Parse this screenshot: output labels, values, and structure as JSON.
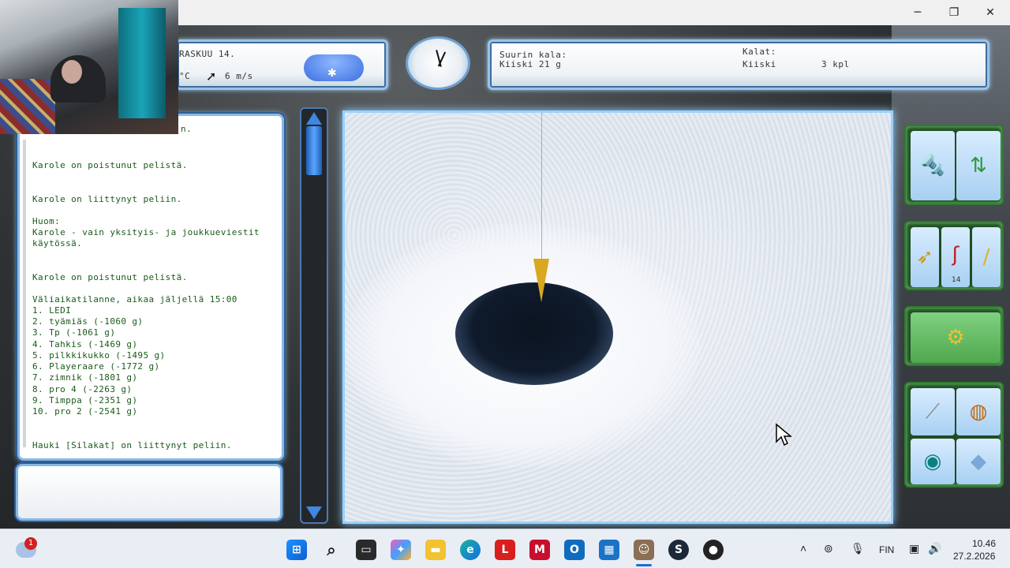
{
  "window": {
    "minimize": "─",
    "maximize": "❐",
    "close": "✕"
  },
  "weather": {
    "date": "RASKUU 14.",
    "temperature_unit": "°C",
    "wind": "6 m/s",
    "icon": "snow-cloud-icon"
  },
  "clock": {
    "icon": "clock-icon"
  },
  "stats": {
    "biggest_label": "Suurin kala:",
    "biggest_value": "Kiiski 21 g",
    "fish_label": "Kalat:",
    "fish_name": "Kiiski",
    "fish_count": "3 kpl"
  },
  "chat": {
    "top_fragment": "n.",
    "lines": [
      "Karole on poistunut pelistä.",
      "Karole on liittynyt peliin.",
      "Huom:",
      "Karole - vain yksityis- ja joukkueviestit",
      "käytössä.",
      "Karole on poistunut pelistä.",
      "Väliaikatilanne, aikaa jäljellä 15:00",
      "1. LEDI",
      "2. tyämiäs (-1060 g)",
      "3. Tp (-1061 g)",
      "4. Tahkis (-1469 g)",
      "5. pilkkikukko (-1495 g)",
      "6. Playeraare (-1772 g)",
      "7. zimnik (-1801 g)",
      "8. pro 4 (-2263 g)",
      "9. Timppa (-2351 g)",
      "10. pro 2 (-2541 g)",
      "Hauki [Silakat] on liittynyt peliin."
    ],
    "input_value": ""
  },
  "tools": {
    "group1": [
      "ice-drill-icon",
      "arrows-swap-icon"
    ],
    "group2": [
      "lure-icon",
      "hook-icon",
      "rod-icon"
    ],
    "group2_count": "14",
    "group3": [
      "fishing-rod-set-icon"
    ],
    "group4": [
      "knife-icon",
      "globe-icon",
      "eye-icon",
      "ice-sheet-icon"
    ]
  },
  "taskbar": {
    "notification_count": "1",
    "language": "FIN",
    "time": "10.46",
    "date": "27.2.2026",
    "apps": [
      "windows-start-icon",
      "search-icon",
      "file-explorer-icon",
      "copilot-icon",
      "folder-icon",
      "edge-icon",
      "l-app-icon",
      "mcafee-icon",
      "outlook-icon",
      "store-icon",
      "game-app-icon",
      "steam-icon",
      "chat-app-icon"
    ]
  }
}
